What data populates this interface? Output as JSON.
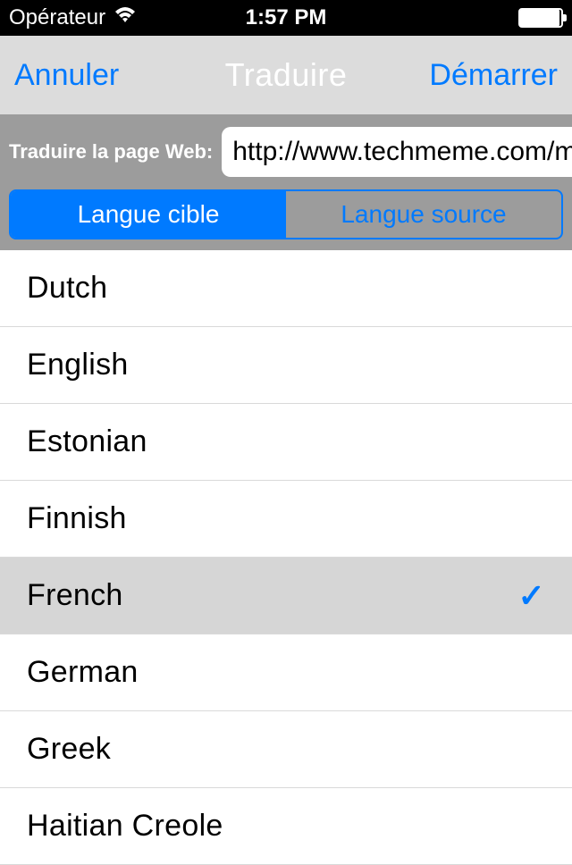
{
  "status": {
    "carrier": "Opérateur",
    "time": "1:57 PM"
  },
  "nav": {
    "cancel": "Annuler",
    "title": "Traduire",
    "start": "Démarrer"
  },
  "toolbar": {
    "url_label": "Traduire la page Web:",
    "url_value": "http://www.techmeme.com/m/",
    "segment_target": "Langue cible",
    "segment_source": "Langue source"
  },
  "languages": [
    {
      "name": "Dutch",
      "selected": false
    },
    {
      "name": "English",
      "selected": false
    },
    {
      "name": "Estonian",
      "selected": false
    },
    {
      "name": "Finnish",
      "selected": false
    },
    {
      "name": "French",
      "selected": true
    },
    {
      "name": "German",
      "selected": false
    },
    {
      "name": "Greek",
      "selected": false
    },
    {
      "name": "Haitian Creole",
      "selected": false
    }
  ]
}
